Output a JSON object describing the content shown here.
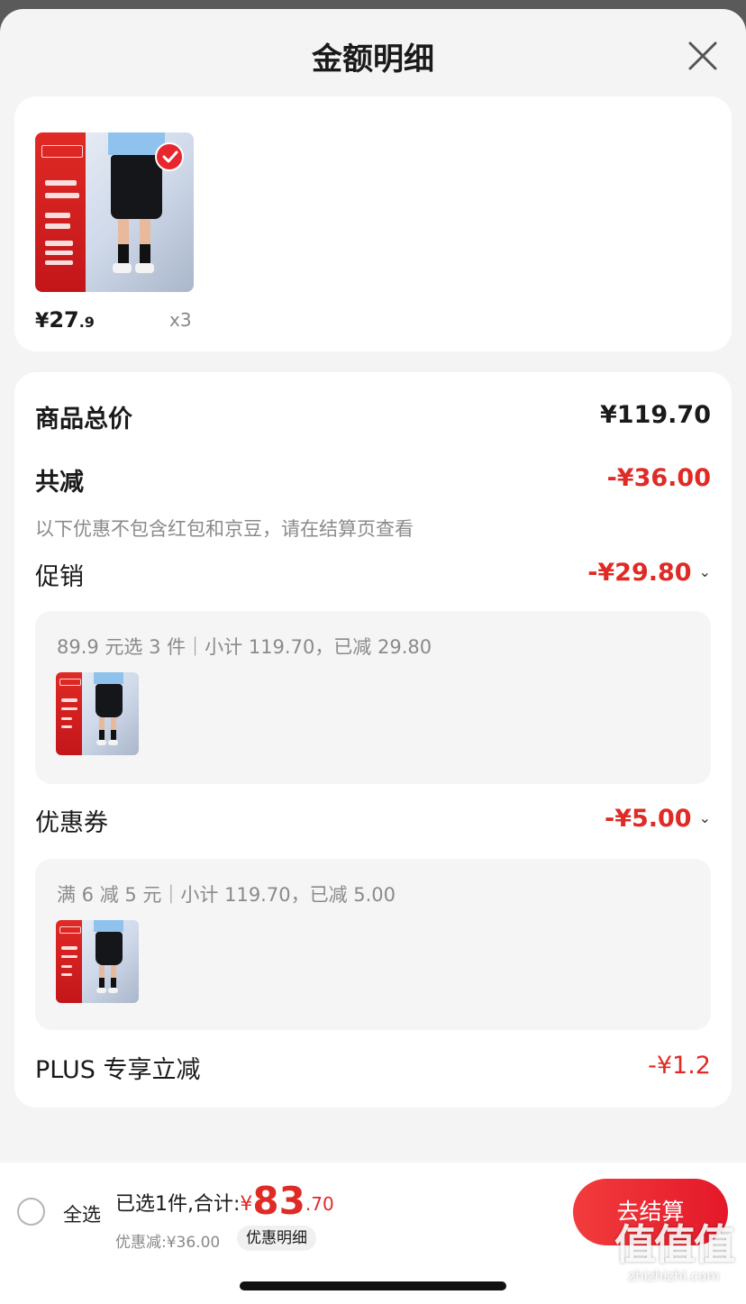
{
  "header": {
    "title": "金额明细"
  },
  "product": {
    "price_symbol": "¥",
    "price_int": "27",
    "price_dec": ".9",
    "quantity": "x3",
    "selected": true
  },
  "details": {
    "goods_total": {
      "label": "商品总价",
      "value": "¥119.70"
    },
    "total_reduction": {
      "label": "共减",
      "value": "-¥36.00"
    },
    "note": "以下优惠不包含红包和京豆，请在结算页查看",
    "promotion": {
      "label": "促销",
      "value": "-¥29.80",
      "desc": "89.9 元选 3 件｜小计 119.70，已减 29.80"
    },
    "coupon": {
      "label": "优惠券",
      "value": "-¥5.00",
      "desc": "满 6 减 5 元｜小计 119.70，已减 5.00"
    },
    "plus": {
      "label": "PLUS 专享立减",
      "value": "-¥1.2"
    }
  },
  "bottom_bar": {
    "select_all": "全选",
    "selected_text": "已选1件,合计:",
    "total_symbol": "¥",
    "total_int": "83",
    "total_dec": ".70",
    "saved_text": "优惠减:¥36.00",
    "detail_link": "优惠明细",
    "checkout": "去结算"
  },
  "watermark": {
    "logo": "值值值",
    "site": "zhizhizhi.com"
  },
  "colors": {
    "accent_red": "#e02a25",
    "background": "#f4f4f4"
  },
  "icons": [
    "close-icon",
    "check-icon",
    "chevron-down-icon",
    "radio-icon"
  ]
}
